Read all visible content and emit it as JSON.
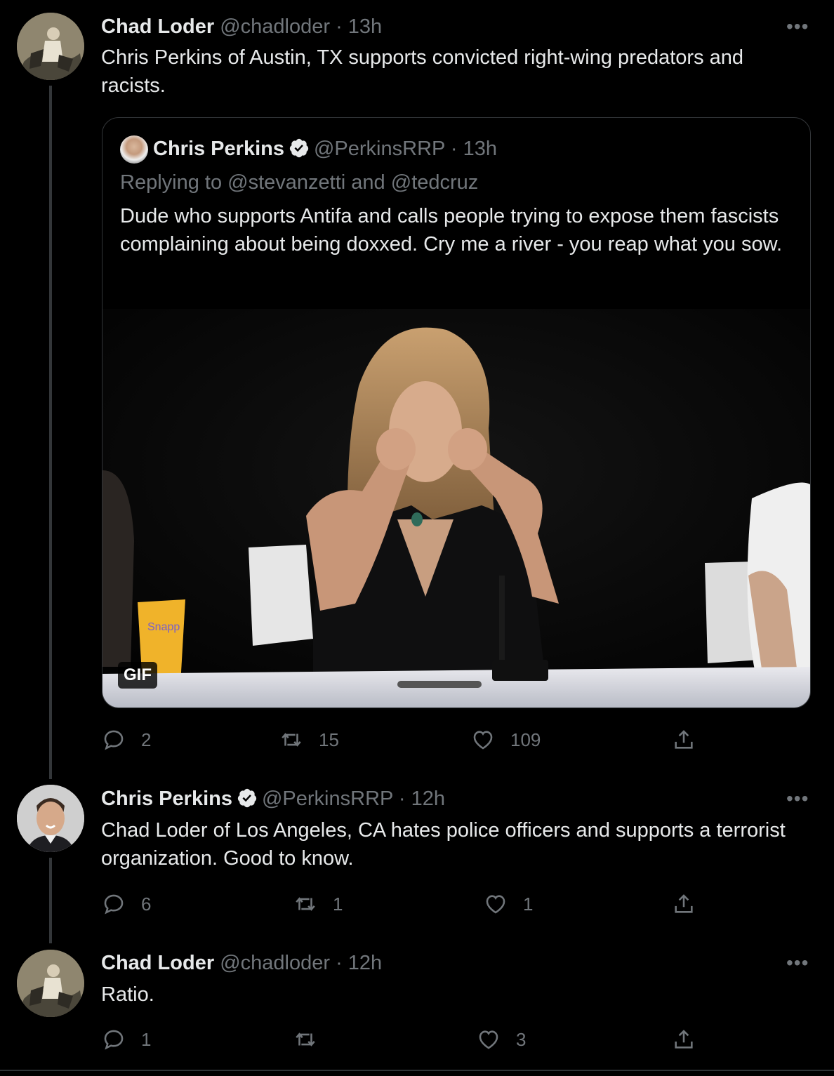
{
  "tweets": [
    {
      "name": "Chad Loder",
      "handle": "@chadloder",
      "time": "13h",
      "text": "Chris Perkins of Austin, TX supports convicted right-wing predators and racists.",
      "quote": {
        "name": "Chris Perkins",
        "handle": "@PerkinsRRP",
        "time": "13h",
        "replying_prefix": "Replying to",
        "reply_to_1": "@stevanzetti",
        "reply_and": "and",
        "reply_to_2": "@tedcruz",
        "text": "Dude who supports Antifa and calls people trying to expose them fascists complaining about being doxxed.  Cry me a river - you reap what you sow.",
        "media_badge": "GIF",
        "cup_text": "Snapp"
      },
      "replies": "2",
      "retweets": "15",
      "likes": "109"
    },
    {
      "name": "Chris Perkins",
      "handle": "@PerkinsRRP",
      "time": "12h",
      "text": "Chad Loder of Los Angeles, CA hates police officers and supports a terrorist organization.  Good to know.",
      "replies": "6",
      "retweets": "1",
      "likes": "1"
    },
    {
      "name": "Chad Loder",
      "handle": "@chadloder",
      "time": "12h",
      "text": "Ratio.",
      "replies": "1",
      "retweets": "",
      "likes": "3"
    }
  ],
  "ui": {
    "dot": "·",
    "more": "•••"
  },
  "icons": [
    "reply-icon",
    "retweet-icon",
    "like-icon",
    "share-icon",
    "more-icon",
    "verified-badge-icon"
  ],
  "colors": {
    "background": "#000000",
    "primary_text": "#e7e9ea",
    "secondary_text": "#71767b",
    "border": "#333639"
  }
}
